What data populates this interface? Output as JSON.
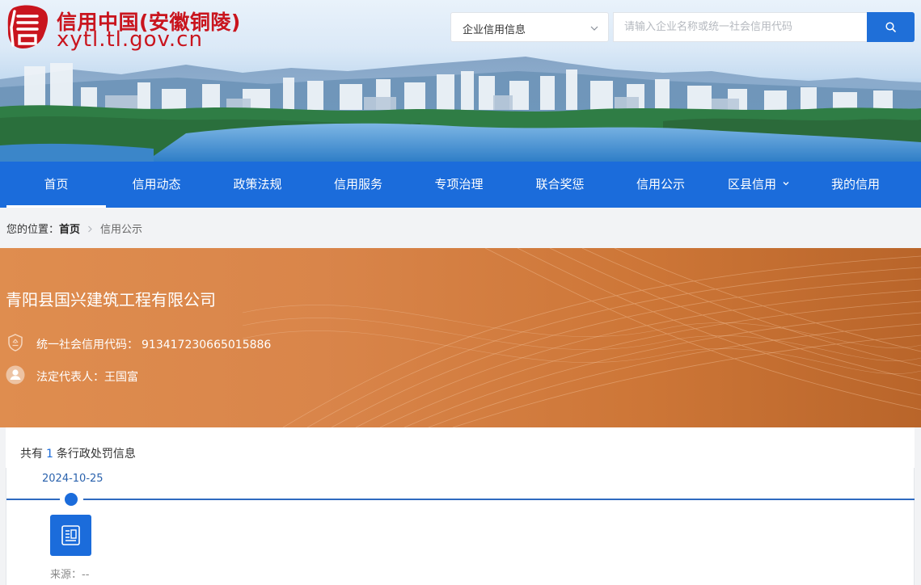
{
  "header": {
    "logo_glyph": "信",
    "title": "信用中国(安徽铜陵)",
    "domain": "xytl.tl.gov.cn",
    "brand_color": "#c9151e"
  },
  "search": {
    "category_selected": "企业信用信息",
    "placeholder": "请输入企业名称或统一社会信用代码",
    "button_icon": "search-icon",
    "accent_color": "#1f6fd8"
  },
  "nav": {
    "items": [
      {
        "label": "首页",
        "active": true
      },
      {
        "label": "信用动态"
      },
      {
        "label": "政策法规"
      },
      {
        "label": "信用服务"
      },
      {
        "label": "专项治理"
      },
      {
        "label": "联合奖惩"
      },
      {
        "label": "信用公示"
      },
      {
        "label": "区县信用",
        "has_dropdown": true
      },
      {
        "label": "我的信用"
      }
    ],
    "color": "#1b6cdb"
  },
  "breadcrumb": {
    "prefix": "您的位置：",
    "home": "首页",
    "current": "信用公示"
  },
  "company": {
    "name": "青阳县国兴建筑工程有限公司",
    "credit_code_label": "统一社会信用代码：",
    "credit_code": "913417230665015886",
    "legal_rep_label": "法定代表人：",
    "legal_rep": "王国富",
    "hero_color": "#d9854a"
  },
  "records": {
    "count_prefix": "共有",
    "count": "1",
    "count_suffix": "条行政处罚信息",
    "items": [
      {
        "date": "2024-10-25",
        "icon": "document-icon",
        "source_label": "来源：",
        "source": "--"
      }
    ]
  }
}
